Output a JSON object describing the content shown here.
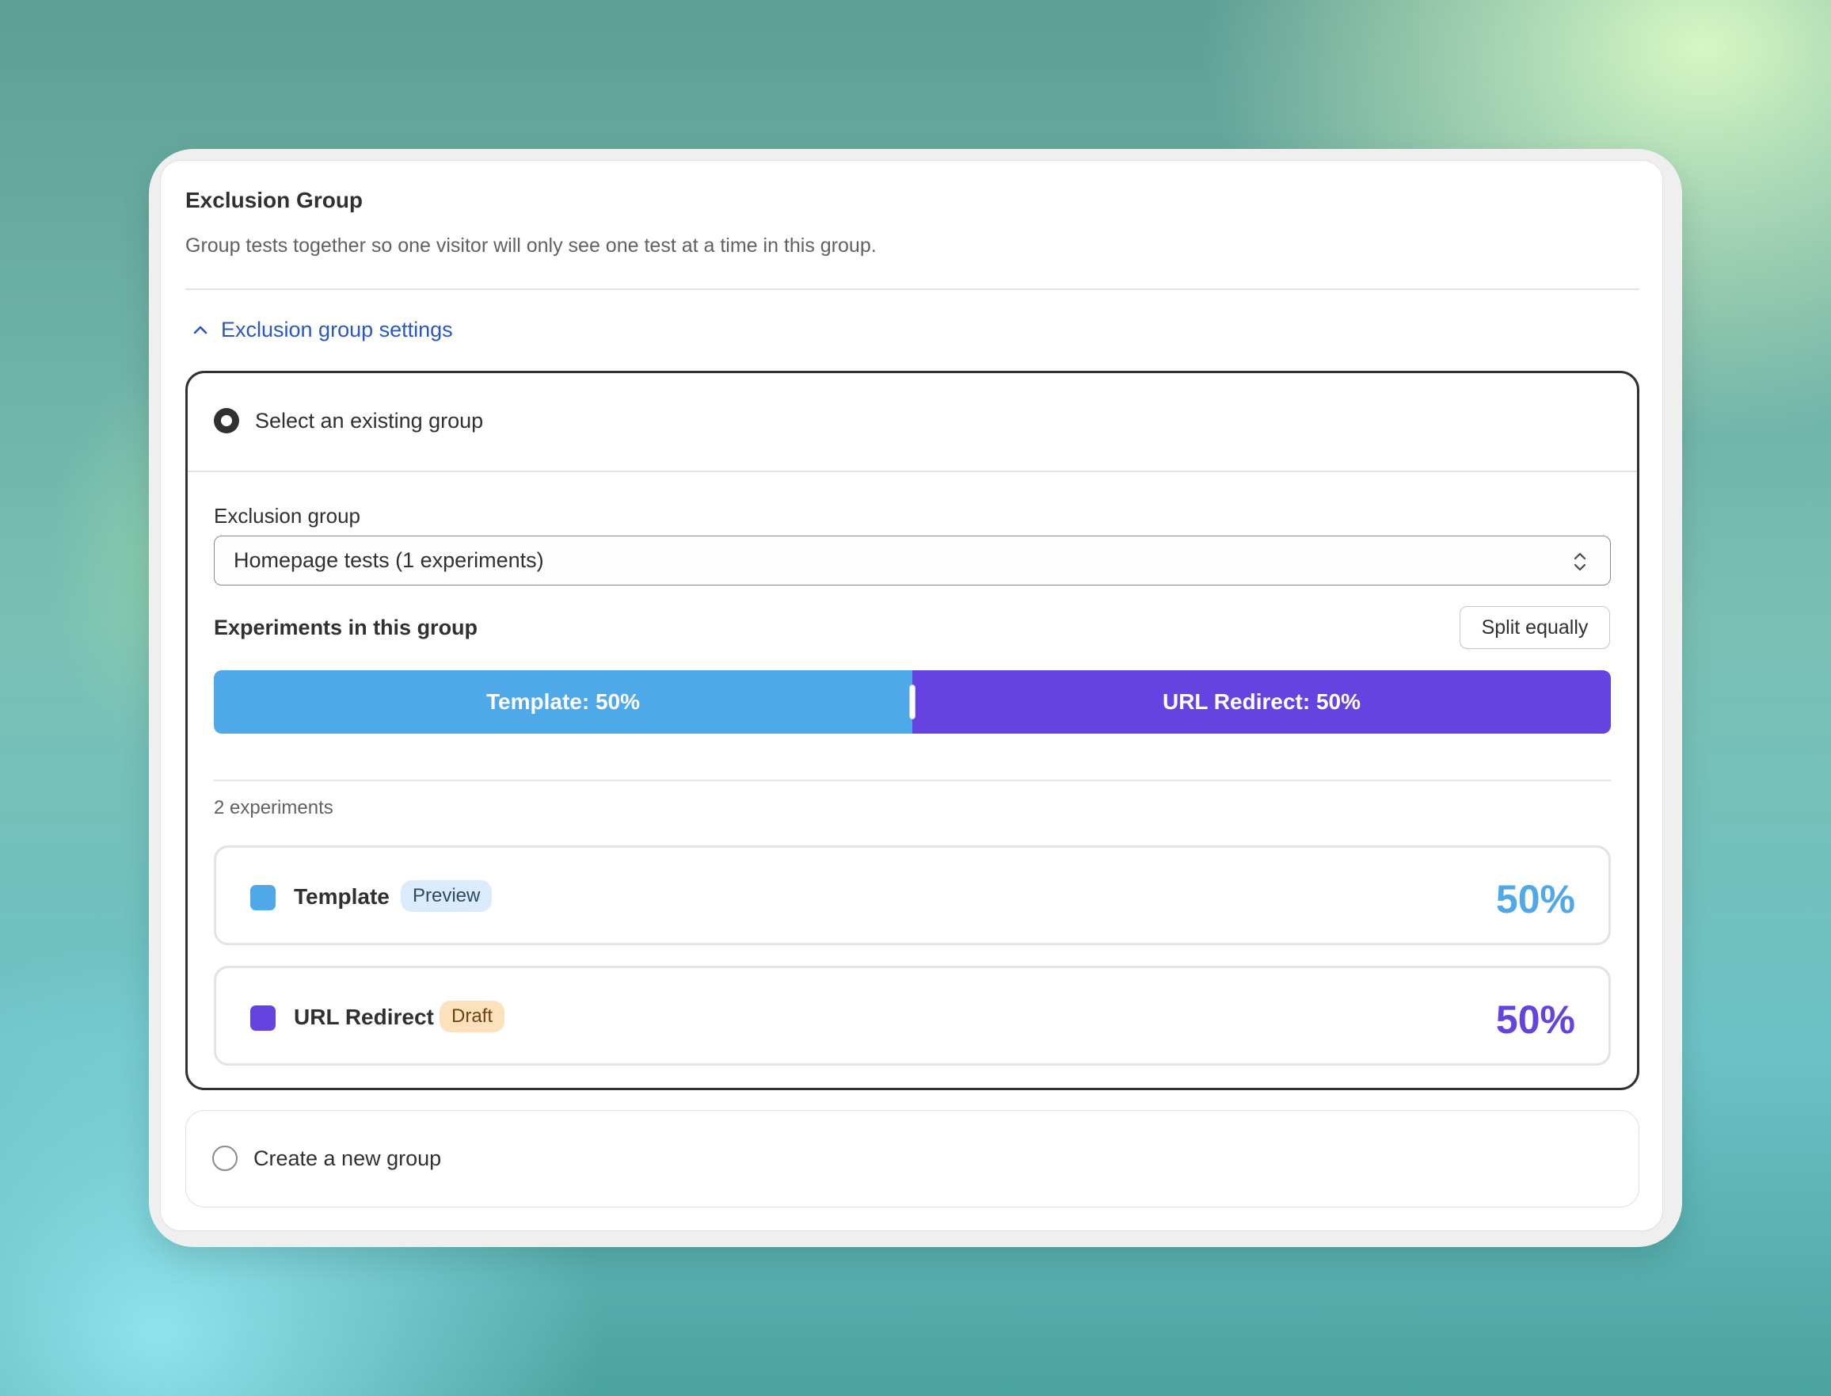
{
  "panel": {
    "title": "Exclusion Group",
    "description": "Group tests together so one visitor will only see one test at a time in this group."
  },
  "settings_toggle": {
    "label": "Exclusion group settings",
    "icon": "chevron-up-icon",
    "expanded": true
  },
  "options": {
    "existing": {
      "label": "Select an existing group",
      "selected": true
    },
    "new": {
      "label": "Create a new group",
      "selected": false
    }
  },
  "exclusion_group_field": {
    "label": "Exclusion group",
    "value": "Homepage tests (1 experiments)",
    "icon": "select-updown-icon"
  },
  "experiments_section": {
    "title": "Experiments in this group",
    "split_button_label": "Split equally",
    "count_label": "2 experiments"
  },
  "allocation_bar": [
    {
      "label": "Template: 50%",
      "share": 50,
      "color": "#4fa8e8"
    },
    {
      "label": "URL Redirect: 50%",
      "share": 50,
      "color": "#6543e0"
    }
  ],
  "experiments": [
    {
      "name": "Template",
      "badge": "Preview",
      "badge_bg": "#dcebfb",
      "badge_fg": "#2c4a63",
      "percent": "50%",
      "color": "#4fa8e8"
    },
    {
      "name": "URL Redirect",
      "badge": "Draft",
      "badge_bg": "#fde1bc",
      "badge_fg": "#6b4410",
      "percent": "50%",
      "color": "#6543e0"
    }
  ],
  "colors": {
    "link": "#2b55c9",
    "text": "#303030",
    "muted": "#616161",
    "border": "#e3e3e3"
  }
}
